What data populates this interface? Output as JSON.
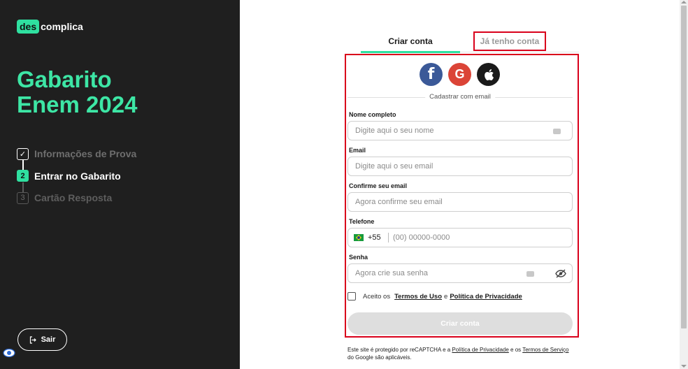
{
  "brand": {
    "logo_box": "des",
    "logo_rest": "complica"
  },
  "sidebar": {
    "headline_line1": "Gabarito",
    "headline_line2": "Enem 2024",
    "steps": [
      {
        "number": "✓",
        "label": "Informações de Prova",
        "state": "done"
      },
      {
        "number": "2",
        "label": "Entrar no Gabarito",
        "state": "current"
      },
      {
        "number": "3",
        "label": "Cartão Resposta",
        "state": "todo"
      }
    ],
    "logout_label": "Sair"
  },
  "tabs": {
    "create": "Criar conta",
    "login": "Já tenho conta"
  },
  "social": {
    "facebook": "f",
    "google": "G"
  },
  "form": {
    "divider_text": "Cadastrar com email",
    "name_label": "Nome completo",
    "name_placeholder": "Digite aqui o seu nome",
    "email_label": "Email",
    "email_placeholder": "Digite aqui o seu email",
    "confirm_label": "Confirme seu email",
    "confirm_placeholder": "Agora confirme seu email",
    "phone_label": "Telefone",
    "phone_prefix": "+55",
    "phone_placeholder": "(00) 00000-0000",
    "password_label": "Senha",
    "password_placeholder": "Agora crie sua senha",
    "terms_prefix": "Aceito os",
    "terms_link": "Termos de Uso",
    "terms_and": "e",
    "privacy_link": "Política de Privacidade",
    "submit_label": "Criar conta"
  },
  "recaptcha": {
    "text1": "Este site é protegido por reCAPTCHA e a ",
    "privacy": "Política de Privacidade",
    "text2": " e os ",
    "terms": "Termos de Serviço",
    "text3": " do Google são aplicáveis."
  },
  "colors": {
    "accent": "#2fe0a0",
    "highlight_border": "#d9001b",
    "sidebar_bg": "#1f1f1f"
  }
}
